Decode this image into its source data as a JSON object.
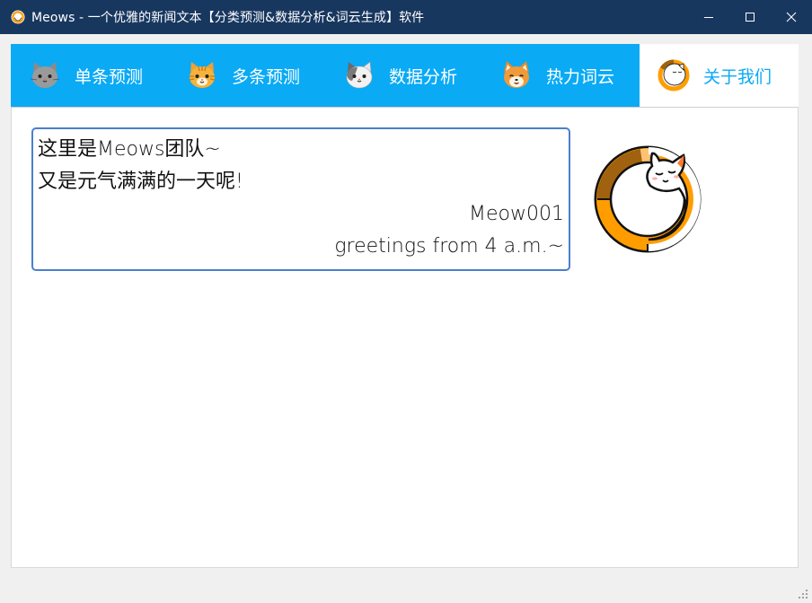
{
  "window": {
    "title": "Meows - 一个优雅的新闻文本【分类预测&数据分析&词云生成】软件",
    "app_icon": "cat-face-icon",
    "controls": {
      "minimize_icon": "minimize-icon",
      "maximize_icon": "maximize-icon",
      "close_icon": "close-icon"
    }
  },
  "colors": {
    "titlebar": "#18375f",
    "tabbar": "#0aaaf5",
    "active_tab_text": "#0aaaf5",
    "box_border": "#4a7fcf",
    "logo_orange": "#ff9d00",
    "logo_brown": "#a0620e"
  },
  "tabs": [
    {
      "label": "单条预测",
      "icon": "gray-cat-icon",
      "active": false
    },
    {
      "label": "多条预测",
      "icon": "tabby-cat-icon",
      "active": false
    },
    {
      "label": "数据分析",
      "icon": "calico-cat-icon",
      "active": false
    },
    {
      "label": "热力词云",
      "icon": "shiba-dog-icon",
      "active": false
    },
    {
      "label": "关于我们",
      "icon": "sleeping-cat-icon",
      "active": true
    }
  ],
  "about": {
    "line1": "这里是Meows团队~",
    "line2": "又是元气满满的一天呢!",
    "signature": "Meow001",
    "note": "greetings from 4 a.m.~",
    "logo_icon": "sleeping-cat-ring-logo"
  }
}
